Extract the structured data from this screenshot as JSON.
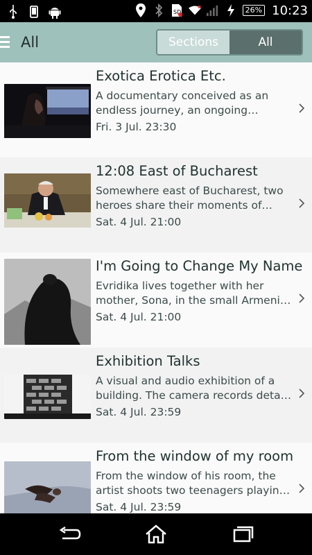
{
  "status_bar": {
    "time": "10:23",
    "battery": "26%",
    "left_icons": [
      "usb-icon",
      "phone-icon",
      "android-icon"
    ],
    "right_icons": [
      "location-icon",
      "bluetooth-icon",
      "sim-icon",
      "wifi-icon",
      "signal-icon",
      "charging-icon"
    ]
  },
  "appbar": {
    "title": "All",
    "tabs": {
      "sections": "Sections",
      "all": "All"
    },
    "selected_tab": "All",
    "colors": {
      "bar": "#9fc1bb",
      "selected": "#5b6f6c",
      "unselected": "#c9dbd8"
    }
  },
  "items": [
    {
      "title": "Exotica Erotica Etc.",
      "desc_line1": "A documentary conceived as an",
      "desc_line2": "endless journey, an ongoing…",
      "date": "Fri. 3 Jul. 23:30",
      "thumb": "woman-at-window"
    },
    {
      "title": "12:08 East of Bucharest",
      "desc_line1": "Somewhere east of Bucharest, two",
      "desc_line2": "heroes share their moments of…",
      "date": "Sat. 4 Jul. 21:00",
      "thumb": "man-at-table"
    },
    {
      "title": "I'm Going to Change My Name",
      "desc_line1": "Evridika lives together with her",
      "desc_line2": "mother, Sona, in the small Armenia…",
      "date": "Sat. 4 Jul. 21:00",
      "thumb": "girl-silhouette"
    },
    {
      "title": "Exhibition Talks",
      "desc_line1": "A visual and audio exhibition of a",
      "desc_line2": "building. The camera records detail…",
      "date": "Sat. 4 Jul. 23:59",
      "thumb": "brick-building"
    },
    {
      "title": "From the window of my room",
      "desc_line1": "From the window of his room, the",
      "desc_line2": "artist shoots two teenagers playing…",
      "date": "Sat. 4 Jul. 23:59",
      "thumb": "teenagers-on-ground"
    }
  ],
  "nav_bar": {
    "buttons": [
      "back-icon",
      "home-icon",
      "recents-icon"
    ]
  }
}
